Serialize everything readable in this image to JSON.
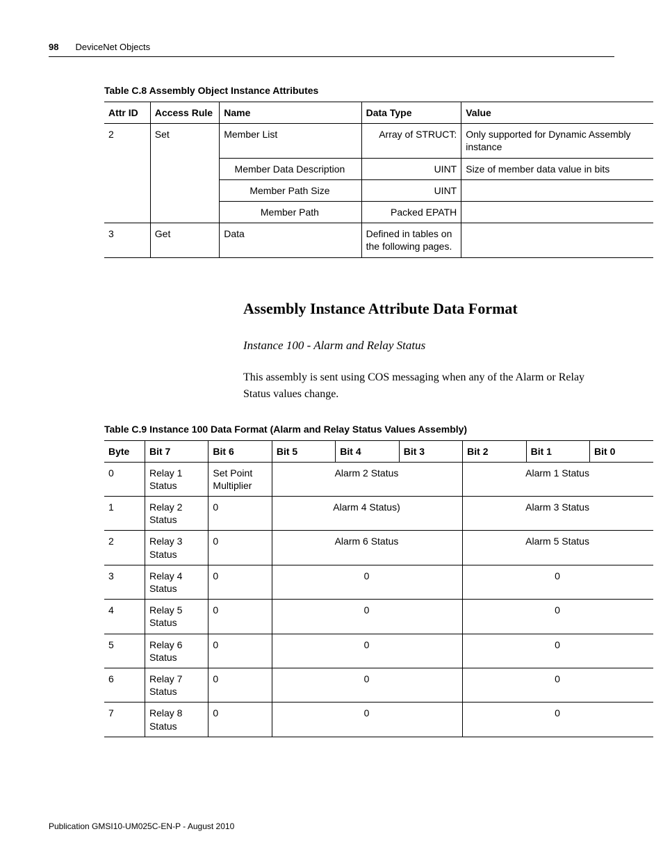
{
  "header": {
    "page_number": "98",
    "section": "DeviceNet Objects"
  },
  "table_c8": {
    "caption": "Table C.8 Assembly Object Instance Attributes",
    "headers": {
      "attr_id": "Attr ID",
      "access_rule": "Access Rule",
      "name": "Name",
      "data_type": "Data Type",
      "value": "Value"
    },
    "rows": [
      {
        "attr_id": "2",
        "access_rule": "Set",
        "name": "Member List",
        "data_type": "Array of STRUCT:",
        "value": "Only supported for Dynamic Assembly instance"
      },
      {
        "name": "Member Data Description",
        "data_type": "UINT",
        "value": "Size of member data value in bits"
      },
      {
        "name": "Member Path Size",
        "data_type": "UINT",
        "value": ""
      },
      {
        "name": "Member Path",
        "data_type": "Packed EPATH",
        "value": ""
      },
      {
        "attr_id": "3",
        "access_rule": "Get",
        "name": "Data",
        "data_type": "Defined in tables on the following pages.",
        "value": ""
      }
    ]
  },
  "section_heading": "Assembly Instance Attribute Data Format",
  "section_subheading": "Instance 100 - Alarm and Relay Status",
  "body_paragraph": "This assembly is sent using COS messaging when any of the Alarm or Relay Status values change.",
  "table_c9": {
    "caption": "Table C.9 Instance 100 Data Format (Alarm and Relay Status Values Assembly)",
    "headers": {
      "byte": "Byte",
      "bit7": "Bit 7",
      "bit6": "Bit 6",
      "bit5": "Bit 5",
      "bit4": "Bit 4",
      "bit3": "Bit 3",
      "bit2": "Bit 2",
      "bit1": "Bit 1",
      "bit0": "Bit 0"
    },
    "rows": [
      {
        "byte": "0",
        "bit7": "Relay 1 Status",
        "bit6": "Set Point Multiplier",
        "bits543": "Alarm 2 Status",
        "bits210": "Alarm 1 Status"
      },
      {
        "byte": "1",
        "bit7": "Relay 2 Status",
        "bit6": "0",
        "bits543": "Alarm 4 Status)",
        "bits210": "Alarm 3 Status"
      },
      {
        "byte": "2",
        "bit7": "Relay 3 Status",
        "bit6": "0",
        "bits543": "Alarm 6 Status",
        "bits210": "Alarm 5 Status"
      },
      {
        "byte": "3",
        "bit7": "Relay 4 Status",
        "bit6": "0",
        "bits543": "0",
        "bits210": "0"
      },
      {
        "byte": "4",
        "bit7": "Relay 5 Status",
        "bit6": "0",
        "bits543": "0",
        "bits210": "0"
      },
      {
        "byte": "5",
        "bit7": "Relay 6 Status",
        "bit6": "0",
        "bits543": "0",
        "bits210": "0"
      },
      {
        "byte": "6",
        "bit7": "Relay 7 Status",
        "bit6": "0",
        "bits543": "0",
        "bits210": "0"
      },
      {
        "byte": "7",
        "bit7": "Relay 8 Status",
        "bit6": "0",
        "bits543": "0",
        "bits210": "0"
      }
    ]
  },
  "footer": "Publication GMSI10-UM025C-EN-P - August 2010"
}
